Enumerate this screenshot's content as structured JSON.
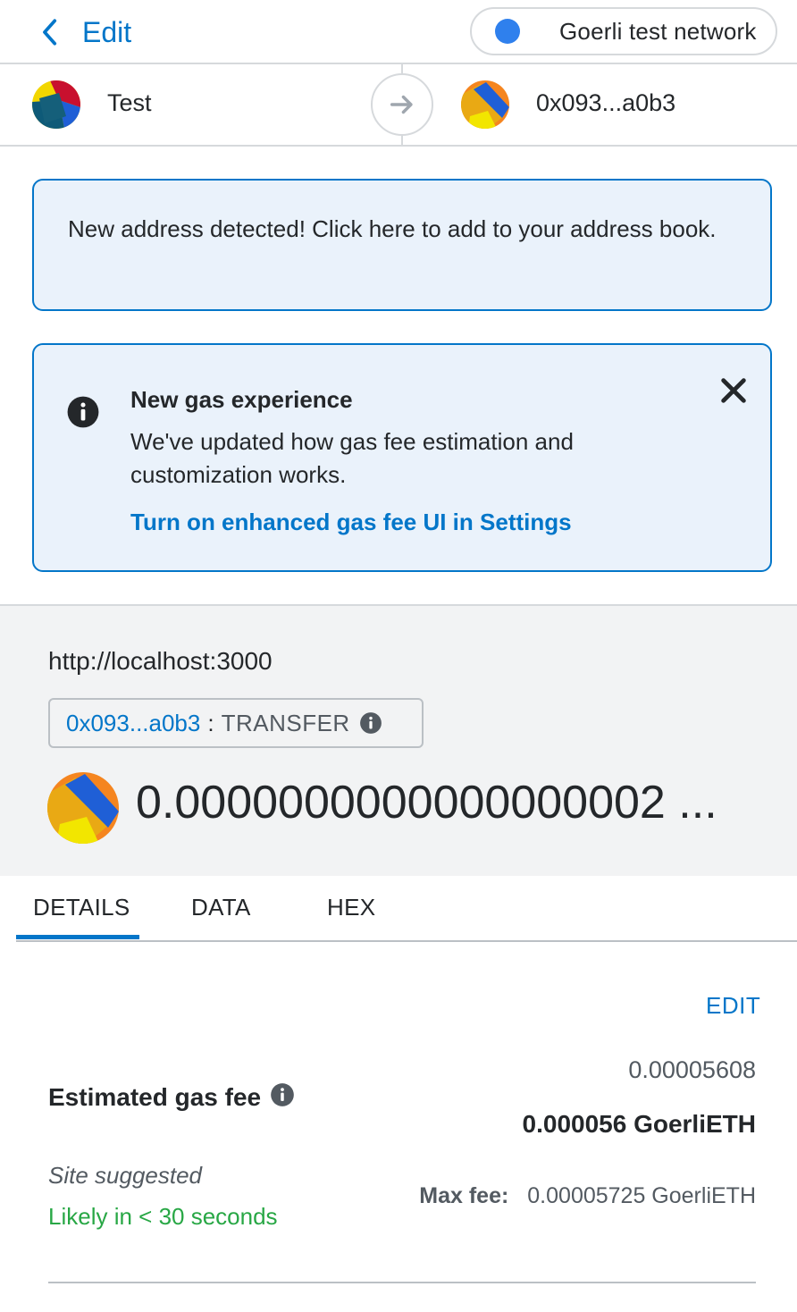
{
  "header": {
    "back_label": "Edit",
    "network_label": "Goerli test network",
    "network_color": "#2f80ed"
  },
  "transfer": {
    "from_name": "Test",
    "to_name": "0x093...a0b3"
  },
  "address_banner": {
    "text": "New address detected! Click here to add to your address book."
  },
  "gas_banner": {
    "title": "New gas experience",
    "description": "We've updated how gas fee estimation and customization works.",
    "link": "Turn on enhanced gas fee UI in Settings"
  },
  "summary": {
    "origin": "http://localhost:3000",
    "method_address": "0x093...a0b3",
    "method_sep": ":",
    "method_name": "TRANSFER",
    "amount": "0.0000000000000000002 ..."
  },
  "tabs": [
    {
      "label": "DETAILS",
      "active": true
    },
    {
      "label": "DATA",
      "active": false
    },
    {
      "label": "HEX",
      "active": false
    }
  ],
  "details": {
    "edit_label": "EDIT",
    "gas_label": "Estimated gas fee",
    "gas_secondary": "0.00005608",
    "gas_primary": "0.000056 GoerliETH",
    "site_suggested": "Site suggested",
    "likely": "Likely in < 30 seconds",
    "maxfee_label": "Max fee:",
    "maxfee_value": "0.00005725 GoerliETH"
  },
  "colors": {
    "accent": "#0376c9",
    "success": "#28a745",
    "banner_bg": "#eaf2fb"
  }
}
